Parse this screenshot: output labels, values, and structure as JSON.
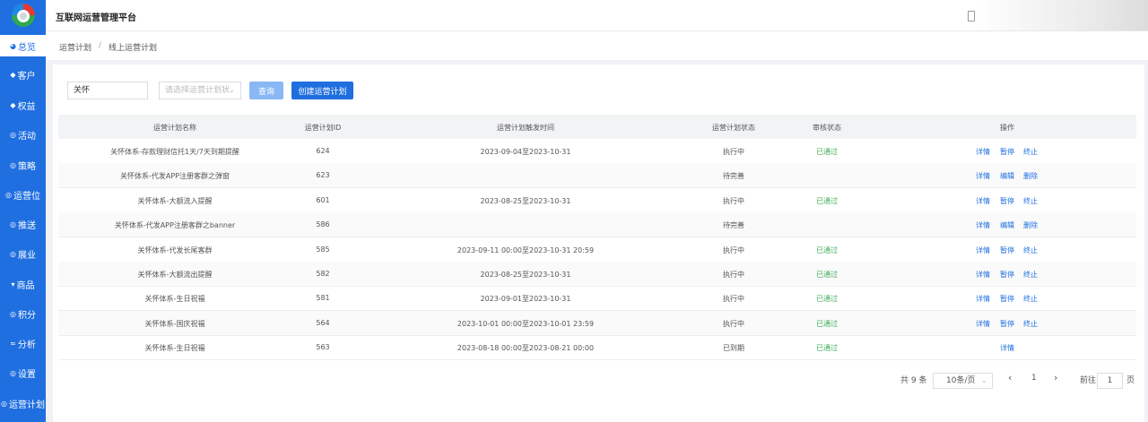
{
  "app": {
    "title": "互联网运营管理平台"
  },
  "sidebar": {
    "items": [
      {
        "label": "总览",
        "icon": "pie-icon",
        "glyph": "◕"
      },
      {
        "label": "客户",
        "icon": "user-icon",
        "glyph": "◆"
      },
      {
        "label": "权益",
        "icon": "gift-icon",
        "glyph": "◆"
      },
      {
        "label": "活动",
        "icon": "activity-icon",
        "glyph": "◎"
      },
      {
        "label": "策略",
        "icon": "strategy-icon",
        "glyph": "◎"
      },
      {
        "label": "运营位",
        "icon": "position-icon",
        "glyph": "◎"
      },
      {
        "label": "推送",
        "icon": "push-icon",
        "glyph": "◎"
      },
      {
        "label": "展业",
        "icon": "business-icon",
        "glyph": "◎"
      },
      {
        "label": "商品",
        "icon": "product-icon",
        "glyph": "▾"
      },
      {
        "label": "积分",
        "icon": "points-icon",
        "glyph": "◎"
      },
      {
        "label": "分析",
        "icon": "analysis-icon",
        "glyph": "≈"
      },
      {
        "label": "设置",
        "icon": "settings-icon",
        "glyph": "◎"
      },
      {
        "label": "运营计划",
        "icon": "plan-icon",
        "glyph": "◎"
      }
    ]
  },
  "breadcrumb": {
    "parent": "运营计划",
    "separator": "/",
    "current": "线上运营计划"
  },
  "filters": {
    "keyword_value": "关怀",
    "status_placeholder": "请选择运营计划状",
    "query_label": "查询",
    "create_label": "创建运营计划"
  },
  "table": {
    "headers": {
      "name": "运营计划名称",
      "id": "运营计划ID",
      "time": "运营计划触发时间",
      "status": "运营计划状态",
      "audit": "审核状态",
      "ops": "操作"
    },
    "rows": [
      {
        "name": "关怀体系-存款理财信托1天/7天到期提醒",
        "id": "624",
        "time": "2023-09-04至2023-10-31",
        "status": "执行中",
        "audit": "已通过",
        "ops": [
          "详情",
          "暂停",
          "终止"
        ]
      },
      {
        "name": "关怀体系-代发APP注册客群之弹窗",
        "id": "623",
        "time": "",
        "status": "待完善",
        "audit": "",
        "ops": [
          "详情",
          "编辑",
          "删除"
        ]
      },
      {
        "name": "关怀体系-大额流入提醒",
        "id": "601",
        "time": "2023-08-25至2023-10-31",
        "status": "执行中",
        "audit": "已通过",
        "ops": [
          "详情",
          "暂停",
          "终止"
        ]
      },
      {
        "name": "关怀体系-代发APP注册客群之banner",
        "id": "586",
        "time": "",
        "status": "待完善",
        "audit": "",
        "ops": [
          "详情",
          "编辑",
          "删除"
        ]
      },
      {
        "name": "关怀体系-代发长尾客群",
        "id": "585",
        "time": "2023-09-11 00:00至2023-10-31 20:59",
        "status": "执行中",
        "audit": "已通过",
        "ops": [
          "详情",
          "暂停",
          "终止"
        ]
      },
      {
        "name": "关怀体系-大额流出提醒",
        "id": "582",
        "time": "2023-08-25至2023-10-31",
        "status": "执行中",
        "audit": "已通过",
        "ops": [
          "详情",
          "暂停",
          "终止"
        ]
      },
      {
        "name": "关怀体系-生日祝福",
        "id": "581",
        "time": "2023-09-01至2023-10-31",
        "status": "执行中",
        "audit": "已通过",
        "ops": [
          "详情",
          "暂停",
          "终止"
        ]
      },
      {
        "name": "关怀体系-国庆祝福",
        "id": "564",
        "time": "2023-10-01 00:00至2023-10-01 23:59",
        "status": "执行中",
        "audit": "已通过",
        "ops": [
          "详情",
          "暂停",
          "终止"
        ]
      },
      {
        "name": "关怀体系-生日祝福",
        "id": "563",
        "time": "2023-08-18 00:00至2023-08-21 00:00",
        "status": "已到期",
        "audit": "已通过",
        "ops": [
          "详情"
        ]
      }
    ]
  },
  "pagination": {
    "total": "共 9 条",
    "page_size": "10条/页",
    "prev": "‹",
    "current_page": "1",
    "next": "›",
    "goto_label": "前往",
    "goto_value": "1",
    "page_suffix": "页"
  },
  "colors": {
    "primary": "#1f6fe0",
    "success": "#3fae5a"
  }
}
